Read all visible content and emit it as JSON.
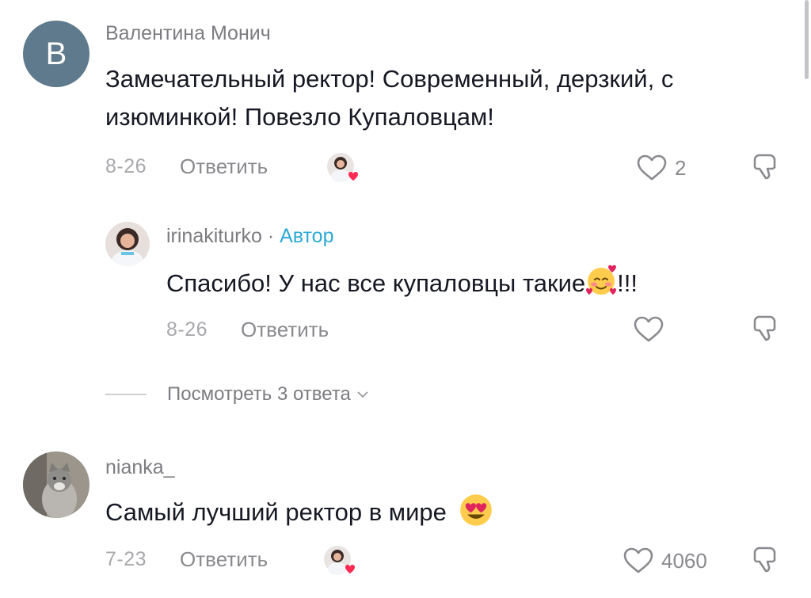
{
  "comments": [
    {
      "avatar_letter": "В",
      "username": "Валентина Монич",
      "text": "Замечательный ректор! Современный, дерзкий, с изюминкой! Повезло Купаловцам!",
      "date": "8-26",
      "reply_label": "Ответить",
      "likes": "2"
    },
    {
      "username": "irinakiturko",
      "separator": "·",
      "author_badge": "Автор",
      "text_before_emoji": "Спасибо! У нас все купаловцы такие",
      "text_after_emoji": "!!!",
      "emoji": "smiling-face-with-hearts",
      "date": "8-26",
      "reply_label": "Ответить",
      "likes": ""
    },
    {
      "username": "nianka_",
      "text": "Самый лучший ректор в мире",
      "emoji": "heart-eyes",
      "date": "7-23",
      "reply_label": "Ответить",
      "likes": "4060"
    }
  ],
  "view_replies": {
    "label": "Посмотреть 3 ответа"
  },
  "colors": {
    "author_badge": "#2aa9d6",
    "liked_heart": "#fe2c55",
    "text": "#161823",
    "secondary": "#8a8a8f"
  }
}
